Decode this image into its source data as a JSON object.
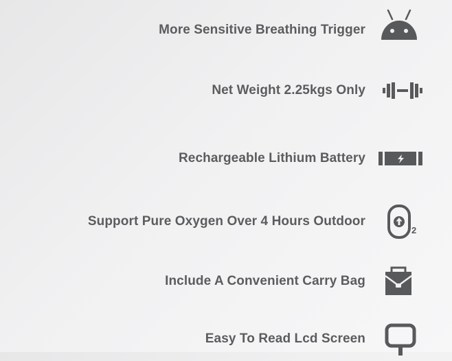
{
  "features": [
    {
      "label": "More Sensitive Breathing Trigger",
      "icon": "android-icon"
    },
    {
      "label": "Net Weight 2.25kgs Only",
      "icon": "dumbbell-icon"
    },
    {
      "label": "Rechargeable Lithium Battery",
      "icon": "battery-icon"
    },
    {
      "label": "Support Pure Oxygen Over 4 Hours Outdoor",
      "icon": "oxygen-tank-icon",
      "icon_subscript": "2"
    },
    {
      "label": "Include A Convenient Carry Bag",
      "icon": "briefcase-icon"
    },
    {
      "label": "Easy To Read Lcd Screen",
      "icon": "screen-icon"
    }
  ],
  "colors": {
    "text": "#5b5c5e",
    "icon": "#58595b",
    "background": "#f0f0f1"
  }
}
